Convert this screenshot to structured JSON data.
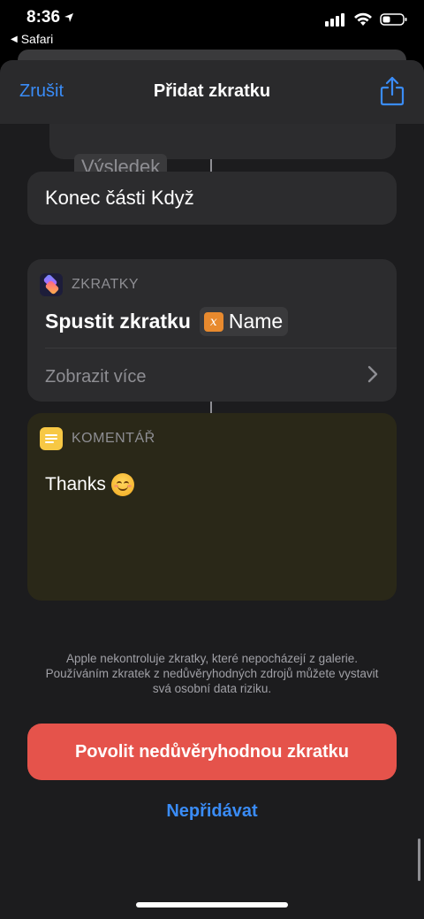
{
  "status": {
    "time": "8:36",
    "back_app": "Safari"
  },
  "nav": {
    "cancel": "Zrušit",
    "title": "Přidat zkratku"
  },
  "result_chip": "Výsledek",
  "end_if": "Konec části Když",
  "shortcuts_action": {
    "app": "ZKRATKY",
    "action": "Spustit zkratku",
    "variable": "Name",
    "show_more": "Zobrazit více"
  },
  "comment": {
    "app": "KOMENTÁŘ",
    "text": "Thanks"
  },
  "disclaimer": "Apple nekontroluje zkratky, které nepocházejí z galerie. Používáním zkratek z nedůvěryhodných zdrojů můžete vystavit svá osobní data riziku.",
  "allow_button": "Povolit nedůvěryhodnou zkratku",
  "dont_add": "Nepřidávat",
  "colors": {
    "accent": "#3a8cf7",
    "danger": "#e5534b",
    "variable": "#e88a2e",
    "comment_icon": "#f7c844"
  }
}
